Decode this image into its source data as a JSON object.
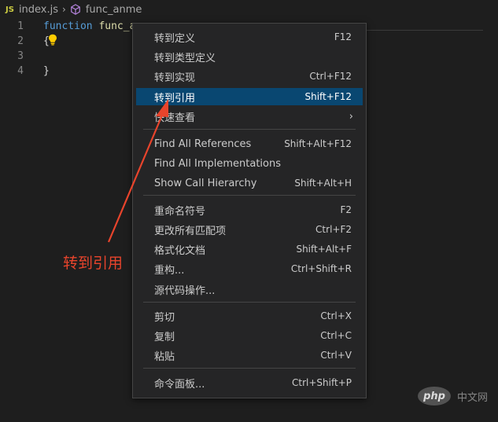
{
  "breadcrumb": {
    "file_badge": "JS",
    "file": "index.js",
    "symbol": "func_anme"
  },
  "editor": {
    "line_numbers": [
      "1",
      "2",
      "3",
      "4"
    ],
    "code_keyword": "function",
    "code_fn": "func_a",
    "code_brace_open": "{",
    "code_brace_close": "}"
  },
  "context_menu": {
    "items": [
      {
        "label": "转到定义",
        "shortcut": "F12"
      },
      {
        "label": "转到类型定义",
        "shortcut": ""
      },
      {
        "label": "转到实现",
        "shortcut": "Ctrl+F12"
      },
      {
        "label": "转到引用",
        "shortcut": "Shift+F12"
      },
      {
        "label": "快速查看",
        "shortcut": ""
      },
      {
        "label": "Find All References",
        "shortcut": "Shift+Alt+F12"
      },
      {
        "label": "Find All Implementations",
        "shortcut": ""
      },
      {
        "label": "Show Call Hierarchy",
        "shortcut": "Shift+Alt+H"
      },
      {
        "label": "重命名符号",
        "shortcut": "F2"
      },
      {
        "label": "更改所有匹配项",
        "shortcut": "Ctrl+F2"
      },
      {
        "label": "格式化文档",
        "shortcut": "Shift+Alt+F"
      },
      {
        "label": "重构...",
        "shortcut": "Ctrl+Shift+R"
      },
      {
        "label": "源代码操作...",
        "shortcut": ""
      },
      {
        "label": "剪切",
        "shortcut": "Ctrl+X"
      },
      {
        "label": "复制",
        "shortcut": "Ctrl+C"
      },
      {
        "label": "粘贴",
        "shortcut": "Ctrl+V"
      },
      {
        "label": "命令面板...",
        "shortcut": "Ctrl+Shift+P"
      }
    ],
    "submenu_chevron": "›"
  },
  "annotation": {
    "text": "转到引用",
    "color": "#e8442c"
  },
  "watermark": {
    "logo": "php",
    "text": "中文网"
  },
  "colors": {
    "selected_bg": "#094771",
    "menu_bg": "#252526",
    "editor_bg": "#1e1e1e"
  }
}
